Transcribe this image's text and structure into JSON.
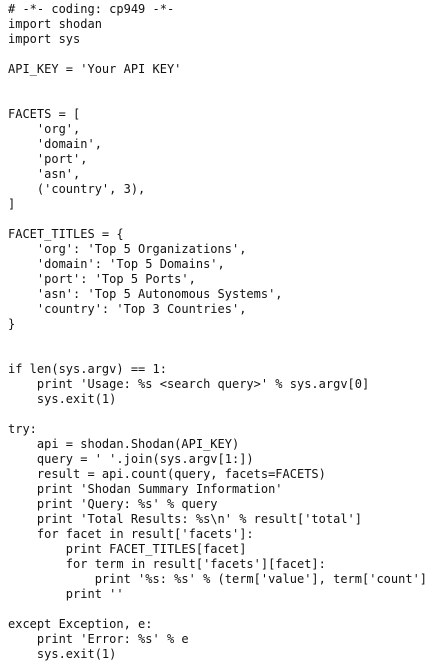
{
  "editor": {
    "language": "python",
    "lines": [
      "# -*- coding: cp949 -*-",
      "import shodan",
      "import sys",
      "",
      "API_KEY = 'Your API KEY'",
      "",
      "",
      "FACETS = [",
      "    'org',",
      "    'domain',",
      "    'port',",
      "    'asn',",
      "    ('country', 3),",
      "]",
      "",
      "FACET_TITLES = {",
      "    'org': 'Top 5 Organizations',",
      "    'domain': 'Top 5 Domains',",
      "    'port': 'Top 5 Ports',",
      "    'asn': 'Top 5 Autonomous Systems',",
      "    'country': 'Top 3 Countries',",
      "}",
      "",
      "",
      "if len(sys.argv) == 1:",
      "    print 'Usage: %s <search query>' % sys.argv[0]",
      "    sys.exit(1)",
      "",
      "try:",
      "    api = shodan.Shodan(API_KEY)",
      "    query = ' '.join(sys.argv[1:])",
      "    result = api.count(query, facets=FACETS)",
      "    print 'Shodan Summary Information'",
      "    print 'Query: %s' % query",
      "    print 'Total Results: %s\\n' % result['total']",
      "    for facet in result['facets']:",
      "        print FACET_TITLES[facet]",
      "        for term in result['facets'][facet]:",
      "            print '%s: %s' % (term['value'], term['count'])",
      "        print ''",
      "",
      "except Exception, e:",
      "    print 'Error: %s' % e",
      "    sys.exit(1)"
    ]
  }
}
